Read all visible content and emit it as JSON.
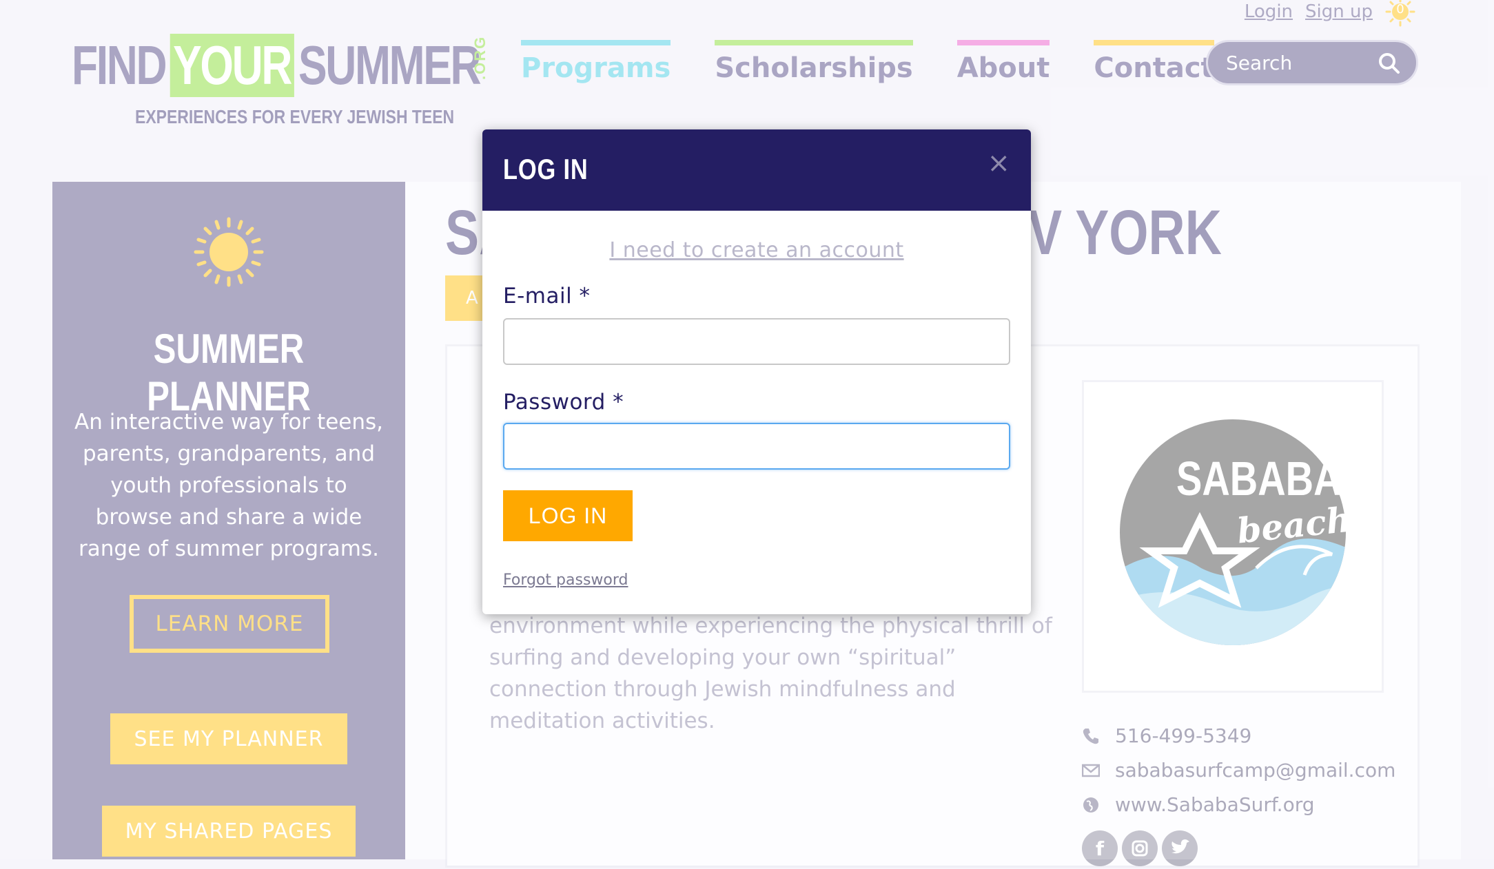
{
  "header": {
    "top_links": {
      "login": "Login",
      "signup": "Sign up"
    },
    "cart_count": "0",
    "logo": {
      "find": "FIND",
      "your": "YOUR",
      "summer": "SUMMER",
      "org": ".ORG",
      "tagline": "EXPERIENCES FOR EVERY JEWISH TEEN"
    },
    "nav": [
      {
        "label": "Programs",
        "color": "#91e1ee"
      },
      {
        "label": "Scholarships",
        "color": "#b8eb86"
      },
      {
        "label": "About",
        "color": "#f39be0"
      },
      {
        "label": "Contact",
        "color": "#ffd96d"
      }
    ],
    "search": {
      "placeholder": "Search",
      "icon": "search-icon"
    }
  },
  "sidebar": {
    "icon": "sun-icon",
    "title": "SUMMER PLANNER",
    "description": "An interactive way for teens, parents, grandparents, and youth professionals to browse and share a wide range of summer programs.",
    "learn_more": "LEARN MORE",
    "see_planner": "SEE MY PLANNER",
    "shared_pages": "MY SHARED PAGES"
  },
  "page": {
    "title_left": "SA",
    "title_right": "V YORK",
    "chip_text": "A",
    "description": "environment while experiencing the physical thrill of surfing and developing your own “spiritual” connection through Jewish mindfulness and meditation activities.",
    "program_logo": {
      "line1": "SABABA",
      "line2": "beach"
    },
    "contact": {
      "phone": "516-499-5349",
      "email": "sababasurfcamp@gmail.com",
      "website": "www.SababaSurf.org"
    },
    "social": [
      "facebook-icon",
      "instagram-icon",
      "twitter-icon"
    ]
  },
  "modal": {
    "title": "LOG IN",
    "close": "×",
    "create_account": "I need to create an account",
    "email_label": "E-mail *",
    "email_value": "",
    "password_label": "Password *",
    "password_value": "",
    "submit": "LOG IN",
    "forgot": "Forgot password"
  },
  "colors": {
    "brand_purple": "#9d98b8",
    "modal_header": "#241e63",
    "accent_orange": "#ffa800",
    "accent_yellow": "#ffd96d",
    "accent_green": "#b8eb86"
  }
}
